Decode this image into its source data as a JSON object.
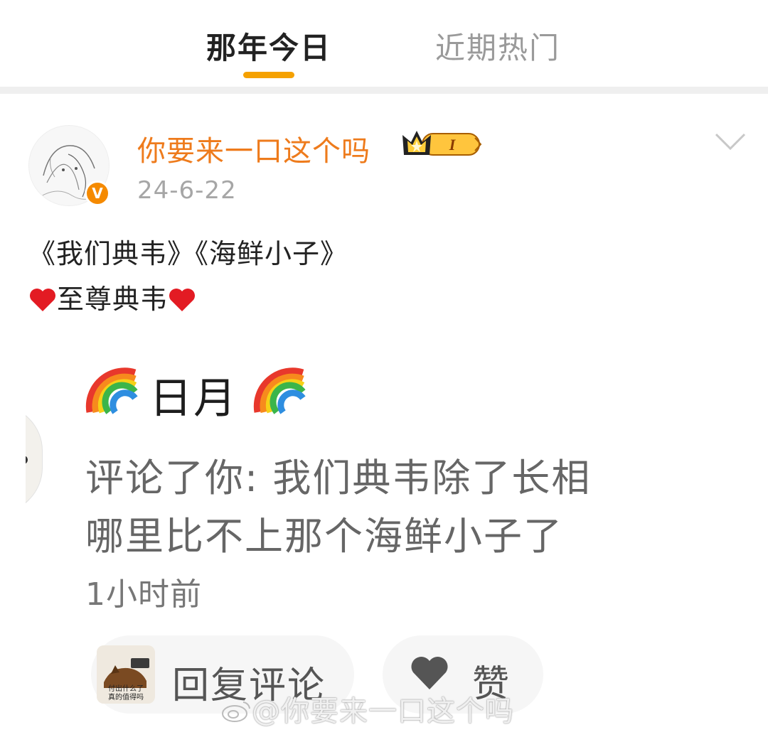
{
  "tabs": {
    "active": "那年今日",
    "inactive": "近期热门"
  },
  "colors": {
    "accent": "#f5a100",
    "username": "#ee7b1c",
    "verified": "#f58a00"
  },
  "post": {
    "author": "你要来一口这个吗",
    "member_badge": "I",
    "verified_mark": "V",
    "date": "24-6-22",
    "line1": "《我们典韦》《海鲜小子》",
    "line2_text": "至尊典韦",
    "heart_icon": "red-heart-icon"
  },
  "screenshot": {
    "name": "日月",
    "comment_line1": "评论了你: 我们典韦除了长相",
    "comment_line2": "哪里比不上那个海鲜小子了",
    "time": "1小时前",
    "reply_thumb_text_1": "付出什么了",
    "reply_thumb_text_2": "真的值得吗",
    "reply_label": "回复评论",
    "like_label": "赞",
    "rainbow_icon": "rainbow-icon"
  },
  "watermark": "@你要来一口这个吗"
}
